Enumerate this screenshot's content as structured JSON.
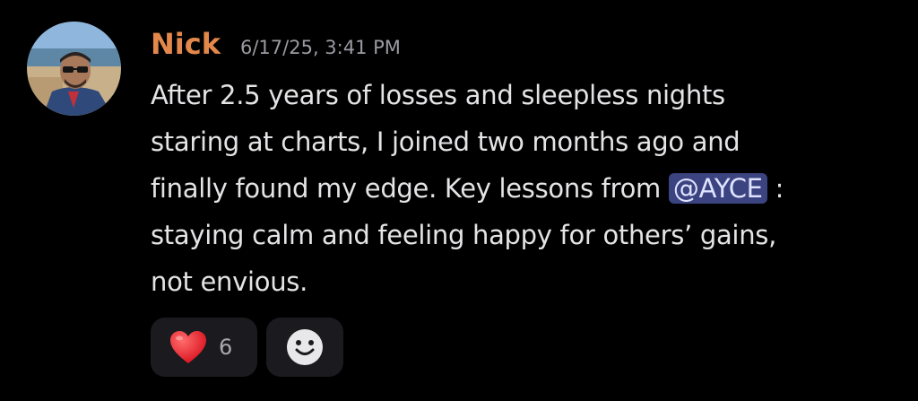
{
  "message": {
    "author": "Nick",
    "timestamp": "6/17/25, 3:41 PM",
    "avatar": "profile-photo-man-sunglasses-beach",
    "lines": [
      "After 2.5 years of losses and sleepless nights",
      "staring at charts, I joined two months ago and"
    ],
    "line3_before_mention": "finally found my edge. Key lessons from ",
    "mention": "@AYCE",
    "line3_after_mention": " :",
    "lines_after": [
      "staying calm and feeling happy for others’ gains,",
      "not envious."
    ]
  },
  "reactions": {
    "heart": {
      "icon": "red-heart-emoji",
      "count": "6"
    },
    "add": {
      "icon": "smiley-add-reaction-icon"
    }
  },
  "colors": {
    "background": "#000000",
    "username": "#e3884a",
    "mention_bg": "#3b4380",
    "reaction_bg": "#1b1b1f"
  }
}
